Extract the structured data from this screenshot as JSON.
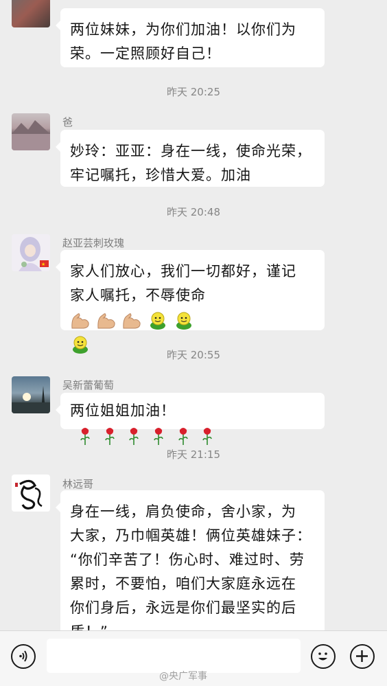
{
  "messages": [
    {
      "sender": "",
      "text_lines": [
        "两位妹妹，为你们加油！以你们为",
        "荣。一定照顾好自己！"
      ]
    },
    {
      "sender": "爸",
      "text_lines": [
        "妙玲：亚亚：身在一线，使命光荣，",
        "牢记嘱托，珍惜大爱。加油"
      ]
    },
    {
      "sender": "赵亚芸刺玫瑰",
      "text_lines": [
        "家人们放心，我们一切都好，谨记",
        "家人嘱托，不辱使命"
      ]
    },
    {
      "sender": "吴新蕾葡萄",
      "text_lines": [
        "两位姐姐加油！"
      ]
    },
    {
      "sender": "林远哥",
      "text_lines": [
        "身在一线，肩负使命，舍小家，为",
        "大家，乃巾帼英雄！俩位英雄妹子：",
        "“你们辛苦了！伤心时、难过时、劳",
        "累时，不要怕，咱们大家庭永远在",
        "你们身后，永远是你们最坚实的后",
        "盾！”"
      ]
    }
  ],
  "timestamps": [
    "昨天 20:25",
    "昨天 20:48",
    "昨天 20:55",
    "昨天 21:15"
  ],
  "emoji": {
    "message3": [
      "flexed-biceps",
      "flexed-biceps",
      "flexed-biceps",
      "frog-face",
      "frog-face",
      "frog-face"
    ],
    "message4": [
      "rose",
      "rose",
      "rose",
      "rose",
      "rose",
      "rose"
    ]
  },
  "bottom_bar": {
    "voice_icon": "voice-icon",
    "emoji_icon": "smiley-icon",
    "plus_icon": "plus-icon",
    "input_value": ""
  },
  "watermark": "@央广军事",
  "colors": {
    "background": "#ededed",
    "bubble": "#ffffff",
    "timestamp": "#868686",
    "sender": "#7d7d7d"
  }
}
